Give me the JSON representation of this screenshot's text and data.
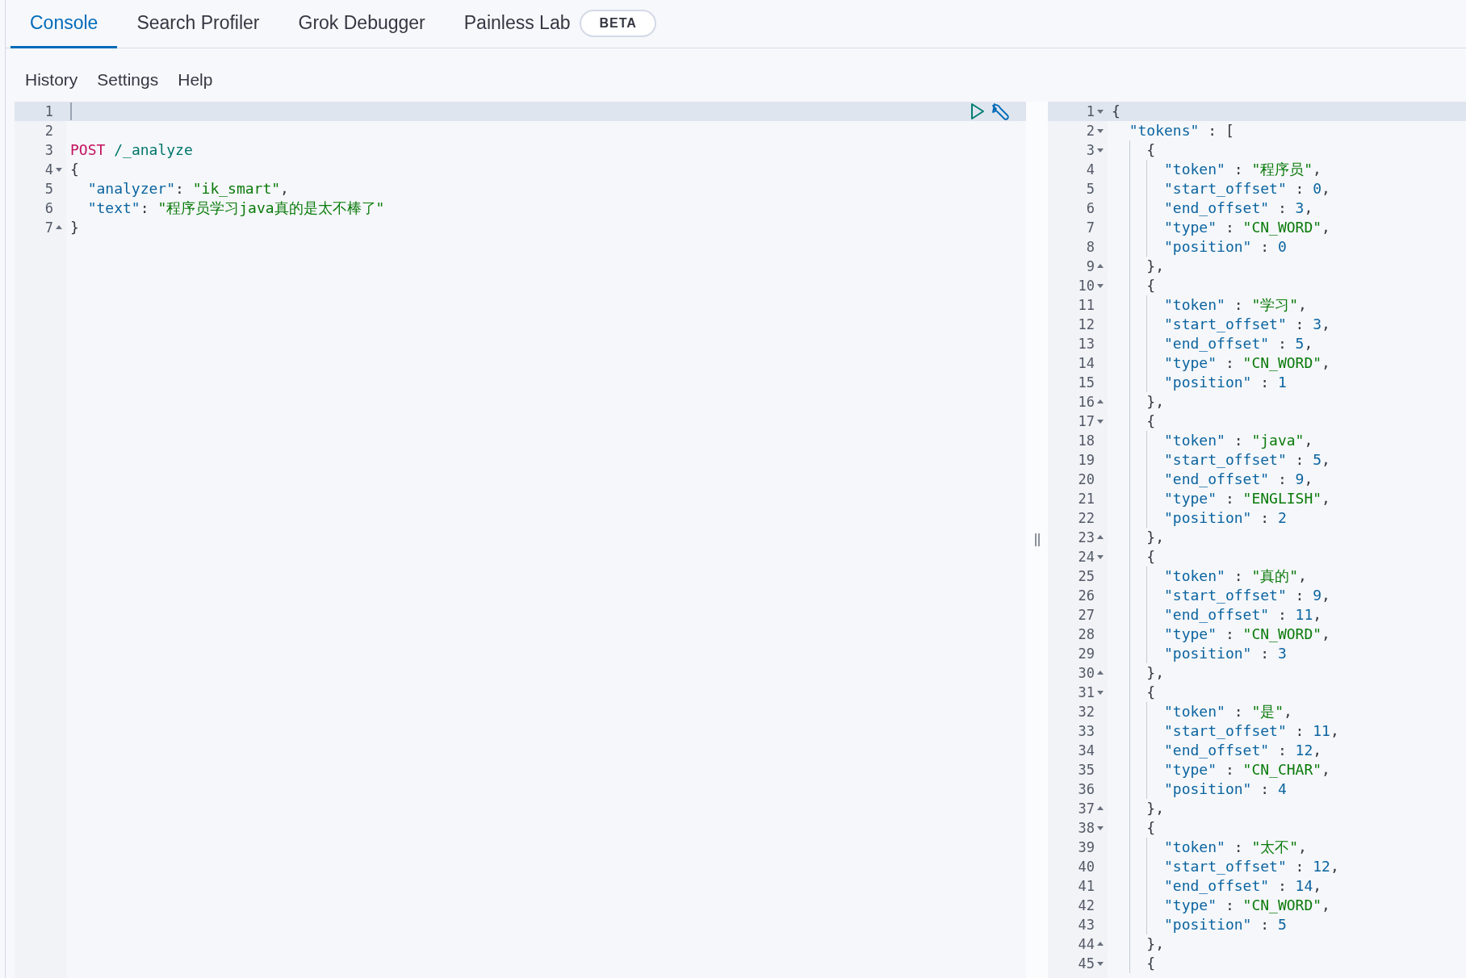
{
  "tabs": [
    {
      "label": "Console",
      "selected": true
    },
    {
      "label": "Search Profiler",
      "selected": false
    },
    {
      "label": "Grok Debugger",
      "selected": false
    },
    {
      "label": "Painless Lab",
      "selected": false,
      "badge": "BETA"
    }
  ],
  "menu": [
    "History",
    "Settings",
    "Help"
  ],
  "request_editor": {
    "lines": [
      {
        "number": "1",
        "active": true,
        "kind": "plain"
      },
      {
        "number": "2",
        "active": false,
        "kind": "plain"
      },
      {
        "number": "3",
        "active": false,
        "kind": "plain",
        "segments": [
          {
            "kind": "method",
            "text": "POST"
          },
          {
            "kind": "path",
            "text": "/_analyze"
          }
        ]
      },
      {
        "number": "4",
        "active": false,
        "kind": "fold_start",
        "segments": [
          {
            "kind": "punct",
            "text": "{"
          }
        ]
      },
      {
        "number": "5",
        "active": false,
        "kind": "plain",
        "segments": [
          {
            "kind": "key",
            "text": "  \"analyzer\""
          },
          {
            "kind": "punct",
            "text": ": "
          },
          {
            "kind": "string",
            "text": "\"ik_smart\""
          },
          {
            "kind": "punct",
            "text": ","
          }
        ]
      },
      {
        "number": "6",
        "active": false,
        "kind": "plain",
        "segments": [
          {
            "kind": "key",
            "text": "  \"text\""
          },
          {
            "kind": "punct",
            "text": ": "
          },
          {
            "kind": "string",
            "text": "\"程序员学习java真的是太不棒了\""
          }
        ]
      },
      {
        "number": "7",
        "active": false,
        "kind": "fold_end",
        "segments": [
          {
            "kind": "punct",
            "text": "}"
          }
        ]
      }
    ]
  },
  "response_editor": {
    "lines": [
      {
        "number": "1",
        "active": true,
        "kind": "fold_start",
        "segments": [
          {
            "kind": "punct",
            "text": "{"
          }
        ]
      },
      {
        "number": "2",
        "active": false,
        "kind": "fold_start",
        "segments": [
          {
            "kind": "key",
            "text": "  \"tokens\""
          },
          {
            "kind": "punct",
            "text": " : ["
          }
        ]
      },
      {
        "number": "3",
        "active": false,
        "kind": "fold_start",
        "segments": [
          {
            "kind": "punct",
            "text": "    {"
          }
        ]
      },
      {
        "number": "4",
        "active": false,
        "kind": "plain",
        "segments": [
          {
            "kind": "key",
            "text": "      \"token\""
          },
          {
            "kind": "punct",
            "text": " : "
          },
          {
            "kind": "string",
            "text": "\"程序员\""
          },
          {
            "kind": "punct",
            "text": ","
          }
        ]
      },
      {
        "number": "5",
        "active": false,
        "kind": "plain",
        "segments": [
          {
            "kind": "key",
            "text": "      \"start_offset\""
          },
          {
            "kind": "punct",
            "text": " : "
          },
          {
            "kind": "number",
            "text": "0"
          },
          {
            "kind": "punct",
            "text": ","
          }
        ]
      },
      {
        "number": "6",
        "active": false,
        "kind": "plain",
        "segments": [
          {
            "kind": "key",
            "text": "      \"end_offset\""
          },
          {
            "kind": "punct",
            "text": " : "
          },
          {
            "kind": "number",
            "text": "3"
          },
          {
            "kind": "punct",
            "text": ","
          }
        ]
      },
      {
        "number": "7",
        "active": false,
        "kind": "plain",
        "segments": [
          {
            "kind": "key",
            "text": "      \"type\""
          },
          {
            "kind": "punct",
            "text": " : "
          },
          {
            "kind": "string",
            "text": "\"CN_WORD\""
          },
          {
            "kind": "punct",
            "text": ","
          }
        ]
      },
      {
        "number": "8",
        "active": false,
        "kind": "plain",
        "segments": [
          {
            "kind": "key",
            "text": "      \"position\""
          },
          {
            "kind": "punct",
            "text": " : "
          },
          {
            "kind": "number",
            "text": "0"
          }
        ]
      },
      {
        "number": "9",
        "active": false,
        "kind": "fold_end",
        "segments": [
          {
            "kind": "punct",
            "text": "    },"
          }
        ]
      },
      {
        "number": "10",
        "active": false,
        "kind": "fold_start",
        "segments": [
          {
            "kind": "punct",
            "text": "    {"
          }
        ]
      },
      {
        "number": "11",
        "active": false,
        "kind": "plain",
        "segments": [
          {
            "kind": "key",
            "text": "      \"token\""
          },
          {
            "kind": "punct",
            "text": " : "
          },
          {
            "kind": "string",
            "text": "\"学习\""
          },
          {
            "kind": "punct",
            "text": ","
          }
        ]
      },
      {
        "number": "12",
        "active": false,
        "kind": "plain",
        "segments": [
          {
            "kind": "key",
            "text": "      \"start_offset\""
          },
          {
            "kind": "punct",
            "text": " : "
          },
          {
            "kind": "number",
            "text": "3"
          },
          {
            "kind": "punct",
            "text": ","
          }
        ]
      },
      {
        "number": "13",
        "active": false,
        "kind": "plain",
        "segments": [
          {
            "kind": "key",
            "text": "      \"end_offset\""
          },
          {
            "kind": "punct",
            "text": " : "
          },
          {
            "kind": "number",
            "text": "5"
          },
          {
            "kind": "punct",
            "text": ","
          }
        ]
      },
      {
        "number": "14",
        "active": false,
        "kind": "plain",
        "segments": [
          {
            "kind": "key",
            "text": "      \"type\""
          },
          {
            "kind": "punct",
            "text": " : "
          },
          {
            "kind": "string",
            "text": "\"CN_WORD\""
          },
          {
            "kind": "punct",
            "text": ","
          }
        ]
      },
      {
        "number": "15",
        "active": false,
        "kind": "plain",
        "segments": [
          {
            "kind": "key",
            "text": "      \"position\""
          },
          {
            "kind": "punct",
            "text": " : "
          },
          {
            "kind": "number",
            "text": "1"
          }
        ]
      },
      {
        "number": "16",
        "active": false,
        "kind": "fold_end",
        "segments": [
          {
            "kind": "punct",
            "text": "    },"
          }
        ]
      },
      {
        "number": "17",
        "active": false,
        "kind": "fold_start",
        "segments": [
          {
            "kind": "punct",
            "text": "    {"
          }
        ]
      },
      {
        "number": "18",
        "active": false,
        "kind": "plain",
        "segments": [
          {
            "kind": "key",
            "text": "      \"token\""
          },
          {
            "kind": "punct",
            "text": " : "
          },
          {
            "kind": "string",
            "text": "\"java\""
          },
          {
            "kind": "punct",
            "text": ","
          }
        ]
      },
      {
        "number": "19",
        "active": false,
        "kind": "plain",
        "segments": [
          {
            "kind": "key",
            "text": "      \"start_offset\""
          },
          {
            "kind": "punct",
            "text": " : "
          },
          {
            "kind": "number",
            "text": "5"
          },
          {
            "kind": "punct",
            "text": ","
          }
        ]
      },
      {
        "number": "20",
        "active": false,
        "kind": "plain",
        "segments": [
          {
            "kind": "key",
            "text": "      \"end_offset\""
          },
          {
            "kind": "punct",
            "text": " : "
          },
          {
            "kind": "number",
            "text": "9"
          },
          {
            "kind": "punct",
            "text": ","
          }
        ]
      },
      {
        "number": "21",
        "active": false,
        "kind": "plain",
        "segments": [
          {
            "kind": "key",
            "text": "      \"type\""
          },
          {
            "kind": "punct",
            "text": " : "
          },
          {
            "kind": "string",
            "text": "\"ENGLISH\""
          },
          {
            "kind": "punct",
            "text": ","
          }
        ]
      },
      {
        "number": "22",
        "active": false,
        "kind": "plain",
        "segments": [
          {
            "kind": "key",
            "text": "      \"position\""
          },
          {
            "kind": "punct",
            "text": " : "
          },
          {
            "kind": "number",
            "text": "2"
          }
        ]
      },
      {
        "number": "23",
        "active": false,
        "kind": "fold_end",
        "segments": [
          {
            "kind": "punct",
            "text": "    },"
          }
        ]
      },
      {
        "number": "24",
        "active": false,
        "kind": "fold_start",
        "segments": [
          {
            "kind": "punct",
            "text": "    {"
          }
        ]
      },
      {
        "number": "25",
        "active": false,
        "kind": "plain",
        "segments": [
          {
            "kind": "key",
            "text": "      \"token\""
          },
          {
            "kind": "punct",
            "text": " : "
          },
          {
            "kind": "string",
            "text": "\"真的\""
          },
          {
            "kind": "punct",
            "text": ","
          }
        ]
      },
      {
        "number": "26",
        "active": false,
        "kind": "plain",
        "segments": [
          {
            "kind": "key",
            "text": "      \"start_offset\""
          },
          {
            "kind": "punct",
            "text": " : "
          },
          {
            "kind": "number",
            "text": "9"
          },
          {
            "kind": "punct",
            "text": ","
          }
        ]
      },
      {
        "number": "27",
        "active": false,
        "kind": "plain",
        "segments": [
          {
            "kind": "key",
            "text": "      \"end_offset\""
          },
          {
            "kind": "punct",
            "text": " : "
          },
          {
            "kind": "number",
            "text": "11"
          },
          {
            "kind": "punct",
            "text": ","
          }
        ]
      },
      {
        "number": "28",
        "active": false,
        "kind": "plain",
        "segments": [
          {
            "kind": "key",
            "text": "      \"type\""
          },
          {
            "kind": "punct",
            "text": " : "
          },
          {
            "kind": "string",
            "text": "\"CN_WORD\""
          },
          {
            "kind": "punct",
            "text": ","
          }
        ]
      },
      {
        "number": "29",
        "active": false,
        "kind": "plain",
        "segments": [
          {
            "kind": "key",
            "text": "      \"position\""
          },
          {
            "kind": "punct",
            "text": " : "
          },
          {
            "kind": "number",
            "text": "3"
          }
        ]
      },
      {
        "number": "30",
        "active": false,
        "kind": "fold_end",
        "segments": [
          {
            "kind": "punct",
            "text": "    },"
          }
        ]
      },
      {
        "number": "31",
        "active": false,
        "kind": "fold_start",
        "segments": [
          {
            "kind": "punct",
            "text": "    {"
          }
        ]
      },
      {
        "number": "32",
        "active": false,
        "kind": "plain",
        "segments": [
          {
            "kind": "key",
            "text": "      \"token\""
          },
          {
            "kind": "punct",
            "text": " : "
          },
          {
            "kind": "string",
            "text": "\"是\""
          },
          {
            "kind": "punct",
            "text": ","
          }
        ]
      },
      {
        "number": "33",
        "active": false,
        "kind": "plain",
        "segments": [
          {
            "kind": "key",
            "text": "      \"start_offset\""
          },
          {
            "kind": "punct",
            "text": " : "
          },
          {
            "kind": "number",
            "text": "11"
          },
          {
            "kind": "punct",
            "text": ","
          }
        ]
      },
      {
        "number": "34",
        "active": false,
        "kind": "plain",
        "segments": [
          {
            "kind": "key",
            "text": "      \"end_offset\""
          },
          {
            "kind": "punct",
            "text": " : "
          },
          {
            "kind": "number",
            "text": "12"
          },
          {
            "kind": "punct",
            "text": ","
          }
        ]
      },
      {
        "number": "35",
        "active": false,
        "kind": "plain",
        "segments": [
          {
            "kind": "key",
            "text": "      \"type\""
          },
          {
            "kind": "punct",
            "text": " : "
          },
          {
            "kind": "string",
            "text": "\"CN_CHAR\""
          },
          {
            "kind": "punct",
            "text": ","
          }
        ]
      },
      {
        "number": "36",
        "active": false,
        "kind": "plain",
        "segments": [
          {
            "kind": "key",
            "text": "      \"position\""
          },
          {
            "kind": "punct",
            "text": " : "
          },
          {
            "kind": "number",
            "text": "4"
          }
        ]
      },
      {
        "number": "37",
        "active": false,
        "kind": "fold_end",
        "segments": [
          {
            "kind": "punct",
            "text": "    },"
          }
        ]
      },
      {
        "number": "38",
        "active": false,
        "kind": "fold_start",
        "segments": [
          {
            "kind": "punct",
            "text": "    {"
          }
        ]
      },
      {
        "number": "39",
        "active": false,
        "kind": "plain",
        "segments": [
          {
            "kind": "key",
            "text": "      \"token\""
          },
          {
            "kind": "punct",
            "text": " : "
          },
          {
            "kind": "string",
            "text": "\"太不\""
          },
          {
            "kind": "punct",
            "text": ","
          }
        ]
      },
      {
        "number": "40",
        "active": false,
        "kind": "plain",
        "segments": [
          {
            "kind": "key",
            "text": "      \"start_offset\""
          },
          {
            "kind": "punct",
            "text": " : "
          },
          {
            "kind": "number",
            "text": "12"
          },
          {
            "kind": "punct",
            "text": ","
          }
        ]
      },
      {
        "number": "41",
        "active": false,
        "kind": "plain",
        "segments": [
          {
            "kind": "key",
            "text": "      \"end_offset\""
          },
          {
            "kind": "punct",
            "text": " : "
          },
          {
            "kind": "number",
            "text": "14"
          },
          {
            "kind": "punct",
            "text": ","
          }
        ]
      },
      {
        "number": "42",
        "active": false,
        "kind": "plain",
        "segments": [
          {
            "kind": "key",
            "text": "      \"type\""
          },
          {
            "kind": "punct",
            "text": " : "
          },
          {
            "kind": "string",
            "text": "\"CN_WORD\""
          },
          {
            "kind": "punct",
            "text": ","
          }
        ]
      },
      {
        "number": "43",
        "active": false,
        "kind": "plain",
        "segments": [
          {
            "kind": "key",
            "text": "      \"position\""
          },
          {
            "kind": "punct",
            "text": " : "
          },
          {
            "kind": "number",
            "text": "5"
          }
        ]
      },
      {
        "number": "44",
        "active": false,
        "kind": "fold_end",
        "segments": [
          {
            "kind": "punct",
            "text": "    },"
          }
        ]
      },
      {
        "number": "45",
        "active": false,
        "kind": "fold_start",
        "segments": [
          {
            "kind": "punct",
            "text": "    {"
          }
        ]
      }
    ]
  }
}
